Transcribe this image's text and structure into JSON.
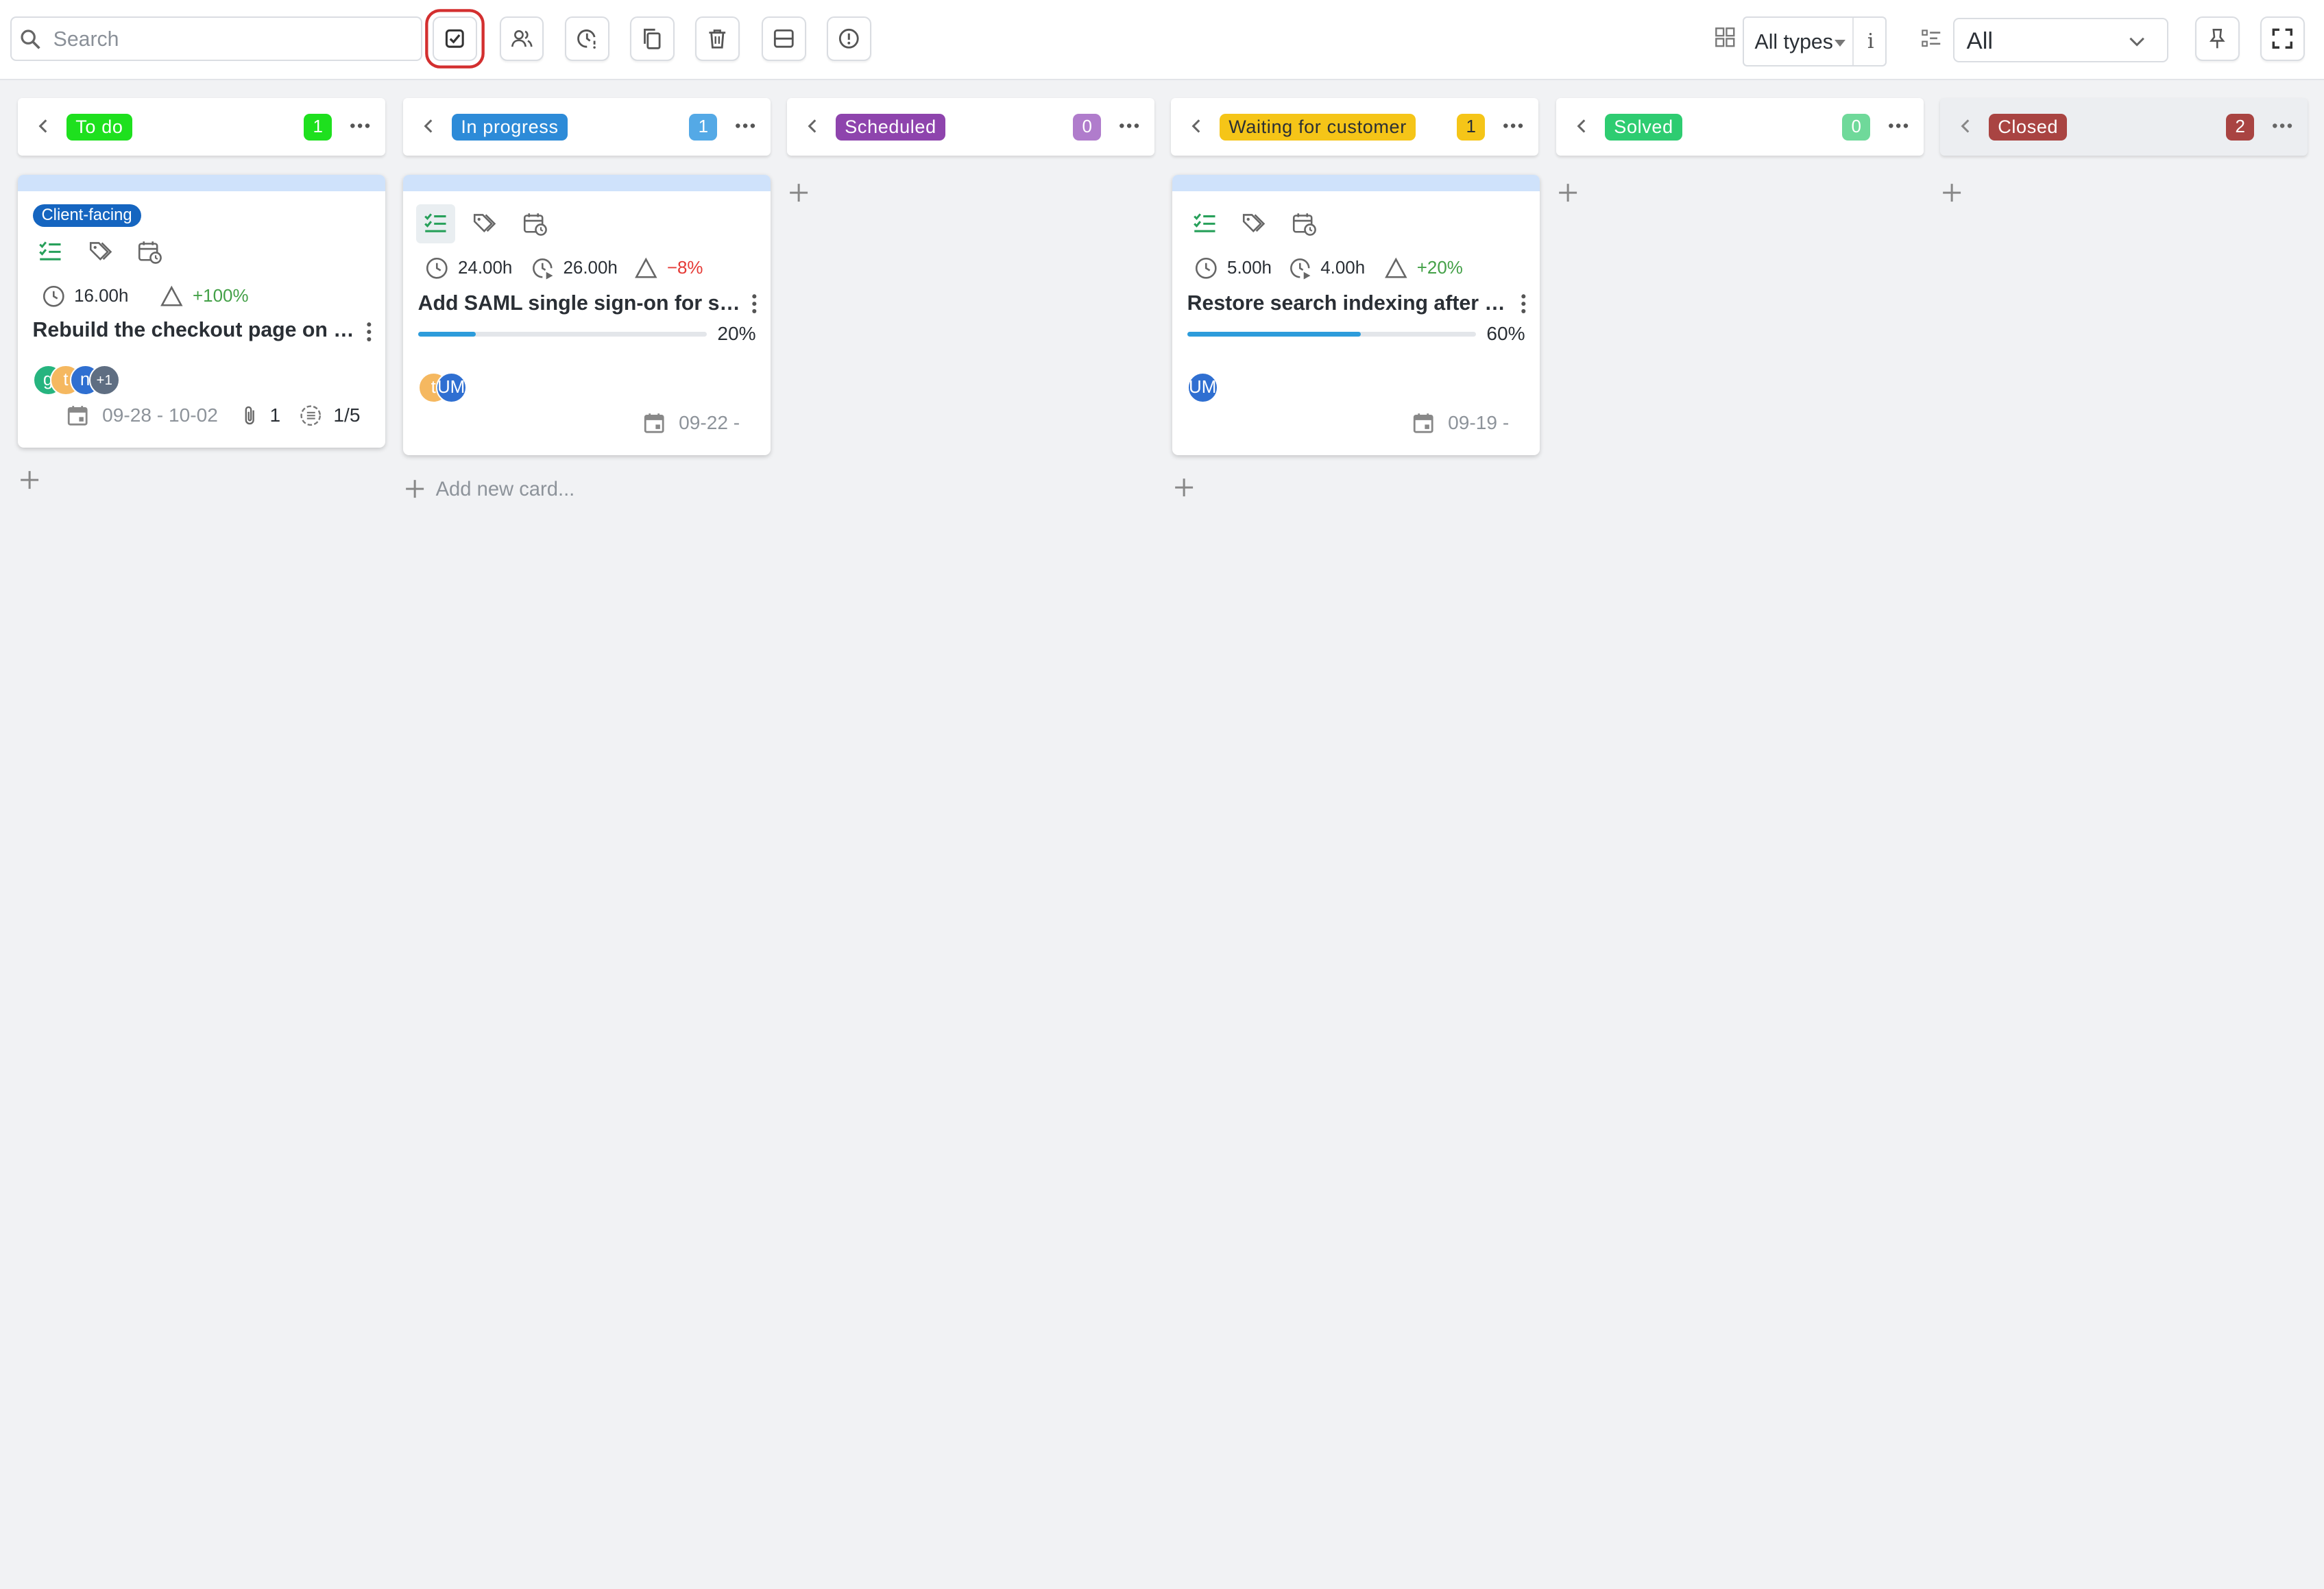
{
  "search": {
    "placeholder": "Search"
  },
  "toolbar": {
    "type_filter": "All types",
    "info": "i",
    "view_filter": "All"
  },
  "columns": [
    {
      "title": "To do",
      "count": "1",
      "color": "#1ee01e",
      "count_color": "#1ee01e"
    },
    {
      "title": "In progress",
      "count": "1",
      "color": "#2d8bd8",
      "count_color": "#54a9e6"
    },
    {
      "title": "Scheduled",
      "count": "0",
      "color": "#8e44ad",
      "count_color": "#b07ccc"
    },
    {
      "title": "Waiting for customer",
      "count": "1",
      "color": "#f5c518",
      "count_color": "#f5c518"
    },
    {
      "title": "Solved",
      "count": "0",
      "color": "#2ecc71",
      "count_color": "#6fd99a"
    },
    {
      "title": "Closed",
      "count": "2",
      "color": "#a94442",
      "count_color": "#a94442"
    }
  ],
  "add_new_card": "Add new card...",
  "cards": [
    {
      "tag": "Client-facing",
      "estimate": "16.00h",
      "variance": "+100%",
      "title": "Rebuild the checkout page on th...",
      "avatars": [
        "g",
        "t",
        "n",
        "+1"
      ],
      "dates": "09-28 - 10-02",
      "attachments": "1",
      "checklist": "1/5"
    },
    {
      "estimate": "24.00h",
      "spent": "26.00h",
      "variance": "−8%",
      "title": "Add SAML single sign-on for staf...",
      "progress": 20,
      "progress_label": "20%",
      "avatars": [
        "t",
        "UM"
      ],
      "dates": "09-22 -"
    },
    {
      "estimate": "5.00h",
      "spent": "4.00h",
      "variance": "+20%",
      "title": "Restore search indexing after th...",
      "progress": 60,
      "progress_label": "60%",
      "avatars": [
        "UM"
      ],
      "dates": "09-19 -"
    }
  ]
}
